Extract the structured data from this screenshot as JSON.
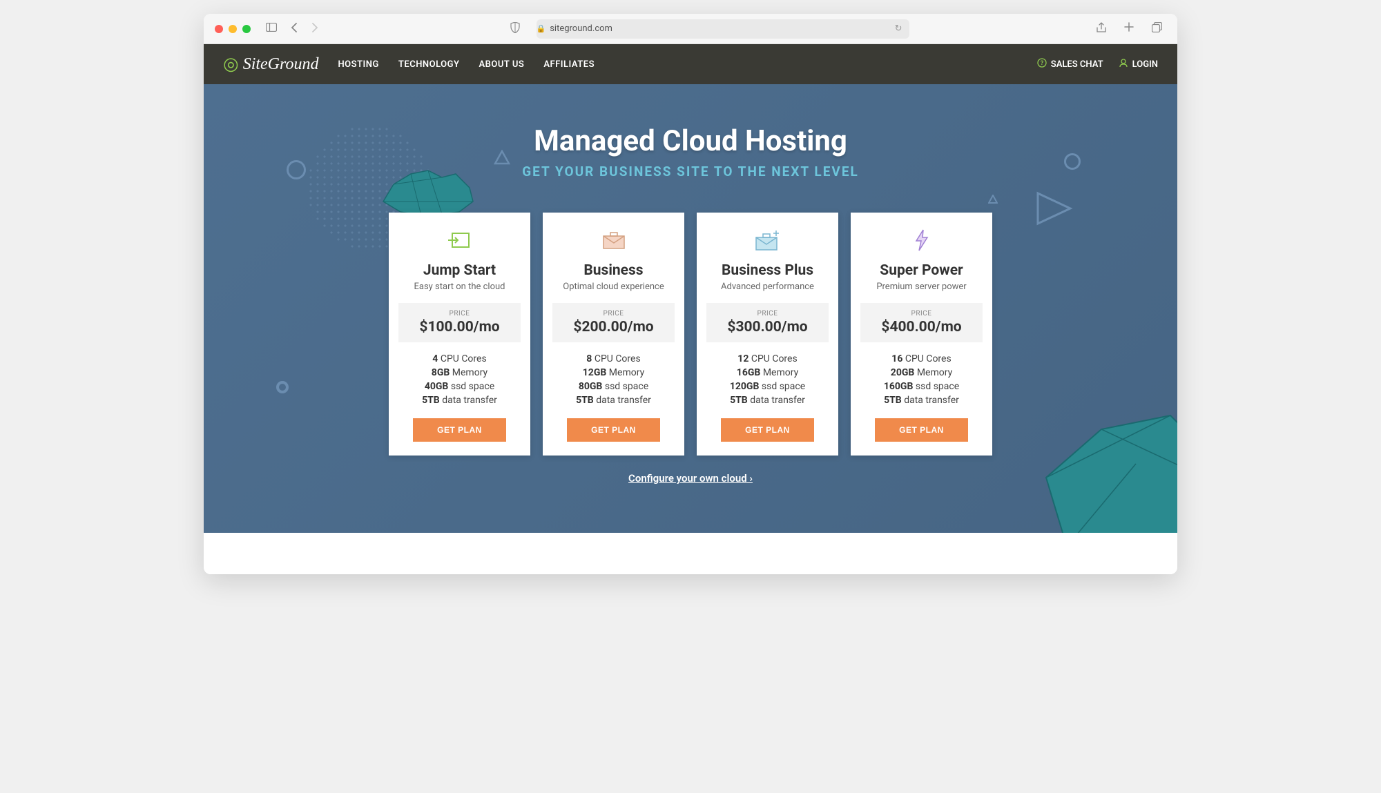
{
  "browser": {
    "url": "siteground.com"
  },
  "navbar": {
    "brand": "SiteGround",
    "links": [
      "HOSTING",
      "TECHNOLOGY",
      "ABOUT US",
      "AFFILIATES"
    ],
    "sales_chat": "SALES CHAT",
    "login": "LOGIN"
  },
  "hero": {
    "title": "Managed Cloud Hosting",
    "subtitle": "GET YOUR BUSINESS SITE TO THE NEXT LEVEL",
    "configure_link": "Configure your own cloud"
  },
  "price_label": "PRICE",
  "cta_label": "GET PLAN",
  "spec_labels": {
    "cpu": "CPU Cores",
    "memory": "Memory",
    "ssd": "ssd space",
    "transfer": "data transfer"
  },
  "plans": [
    {
      "name": "Jump Start",
      "tagline": "Easy start on the cloud",
      "price": "$100.00/mo",
      "cpu": "4",
      "memory": "8GB",
      "ssd": "40GB",
      "transfer": "5TB"
    },
    {
      "name": "Business",
      "tagline": "Optimal cloud experience",
      "price": "$200.00/mo",
      "cpu": "8",
      "memory": "12GB",
      "ssd": "80GB",
      "transfer": "5TB"
    },
    {
      "name": "Business Plus",
      "tagline": "Advanced performance",
      "price": "$300.00/mo",
      "cpu": "12",
      "memory": "16GB",
      "ssd": "120GB",
      "transfer": "5TB"
    },
    {
      "name": "Super Power",
      "tagline": "Premium server power",
      "price": "$400.00/mo",
      "cpu": "16",
      "memory": "20GB",
      "ssd": "160GB",
      "transfer": "5TB"
    }
  ]
}
